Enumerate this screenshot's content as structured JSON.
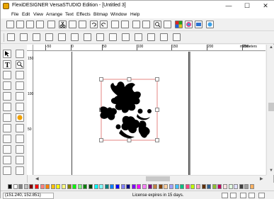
{
  "window": {
    "title": "FlexiDESIGNER VersaSTUDIO Edition - [Untitled 3]",
    "minimize_glyph": "—",
    "maximize_glyph": "☐",
    "close_glyph": "✕"
  },
  "menu": [
    "File",
    "Edit",
    "View",
    "Arrange",
    "Text",
    "Effects",
    "Bitmap",
    "Window",
    "Help"
  ],
  "ruler": {
    "h_labels": [
      "-50",
      "0",
      "50",
      "100",
      "150",
      "200",
      "250"
    ],
    "unit": "millimeters",
    "v_labels": [
      "150",
      "100",
      "50"
    ]
  },
  "status": {
    "coordinates": "(151.240,  152.851)",
    "license": "License expires in 15 days."
  },
  "colors": {
    "accent": "#e8a400",
    "selection": "#d9534f",
    "palette": [
      "#000000",
      "#ffffff",
      "#808080",
      "#c0c0c0",
      "#800000",
      "#ff0000",
      "#ff8080",
      "#ff8000",
      "#ffc000",
      "#ffff00",
      "#ffff80",
      "#808000",
      "#00ff00",
      "#80ff80",
      "#008000",
      "#004000",
      "#00ffff",
      "#80ffff",
      "#008080",
      "#0080ff",
      "#0000ff",
      "#8080ff",
      "#000080",
      "#8000ff",
      "#ff00ff",
      "#ff80ff",
      "#800080",
      "#c08040",
      "#804000",
      "#ffd0a0",
      "#a0a0ff",
      "#40c0ff",
      "#00c080",
      "#ff4080",
      "#c0ff00",
      "#ffa0c0",
      "#603000",
      "#306090",
      "#90c030",
      "#c00060",
      "#ffe0e0",
      "#e0ffe0",
      "#e0e0ff",
      "#404040",
      "#a0a0a0",
      "#ffb060"
    ]
  }
}
